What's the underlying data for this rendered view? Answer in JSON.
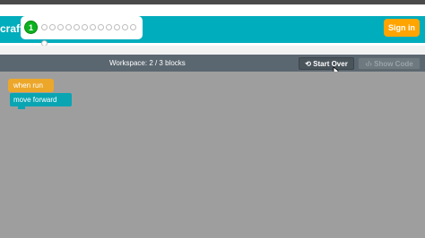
{
  "header": {
    "title": "craft",
    "current_level": "1",
    "remaining_levels": 13,
    "signin_label": "Sign in"
  },
  "workspace": {
    "label": "Workspace: 2 / 3 blocks",
    "start_over_label": "Start Over",
    "show_code_label": "Show Code"
  },
  "blocks": {
    "when_run": "when run",
    "move_forward": "move forward"
  },
  "colors": {
    "header": "#00adbc",
    "signin": "#ffa400",
    "when_run": "#eca72a",
    "move_forward": "#0aa5b3",
    "workspace": "#9e9e9e"
  }
}
